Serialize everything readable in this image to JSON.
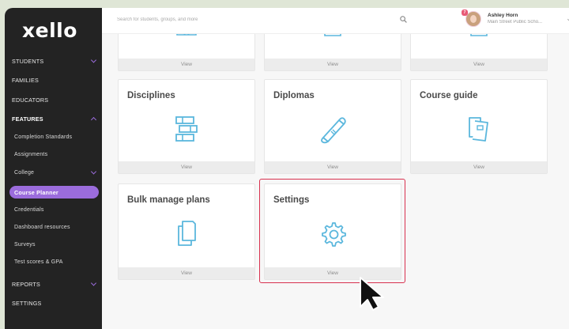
{
  "app": {
    "logo": "xello"
  },
  "search": {
    "placeholder": "Search for students, groups, and more"
  },
  "user": {
    "name": "Ashley Horn",
    "school": "Main Street Public Scho...",
    "notification_count": "7"
  },
  "sidebar": {
    "items": [
      {
        "label": "STUDENTS",
        "chevron": "down"
      },
      {
        "label": "FAMILIES"
      },
      {
        "label": "EDUCATORS"
      },
      {
        "label": "FEATURES",
        "chevron": "up"
      },
      {
        "label": "Completion Standards"
      },
      {
        "label": "Assignments"
      },
      {
        "label": "College",
        "chevron": "down"
      },
      {
        "label": "Course Planner",
        "active": true
      },
      {
        "label": "Credentials"
      },
      {
        "label": "Dashboard resources"
      },
      {
        "label": "Surveys"
      },
      {
        "label": "Test scores & GPA"
      },
      {
        "label": "REPORTS",
        "chevron": "down"
      },
      {
        "label": "SETTINGS"
      }
    ]
  },
  "cards": {
    "view_label": "View",
    "top_row": [
      {
        "view": "View"
      },
      {
        "view": "View"
      },
      {
        "view": "View"
      }
    ],
    "disciplines": {
      "title": "Disciplines",
      "icon": "stacked-books-icon",
      "view": "View"
    },
    "diplomas": {
      "title": "Diplomas",
      "icon": "diploma-scroll-icon",
      "view": "View"
    },
    "course_guide": {
      "title": "Course guide",
      "icon": "course-guide-icon",
      "view": "View"
    },
    "bulk_manage": {
      "title": "Bulk manage plans",
      "icon": "documents-icon",
      "view": "View"
    },
    "settings": {
      "title": "Settings",
      "icon": "gear-icon",
      "view": "View"
    }
  },
  "colors": {
    "accent": "#9b6cdc",
    "icon": "#5bb7dd",
    "highlight": "#d8314f",
    "sidebar": "#232323"
  }
}
